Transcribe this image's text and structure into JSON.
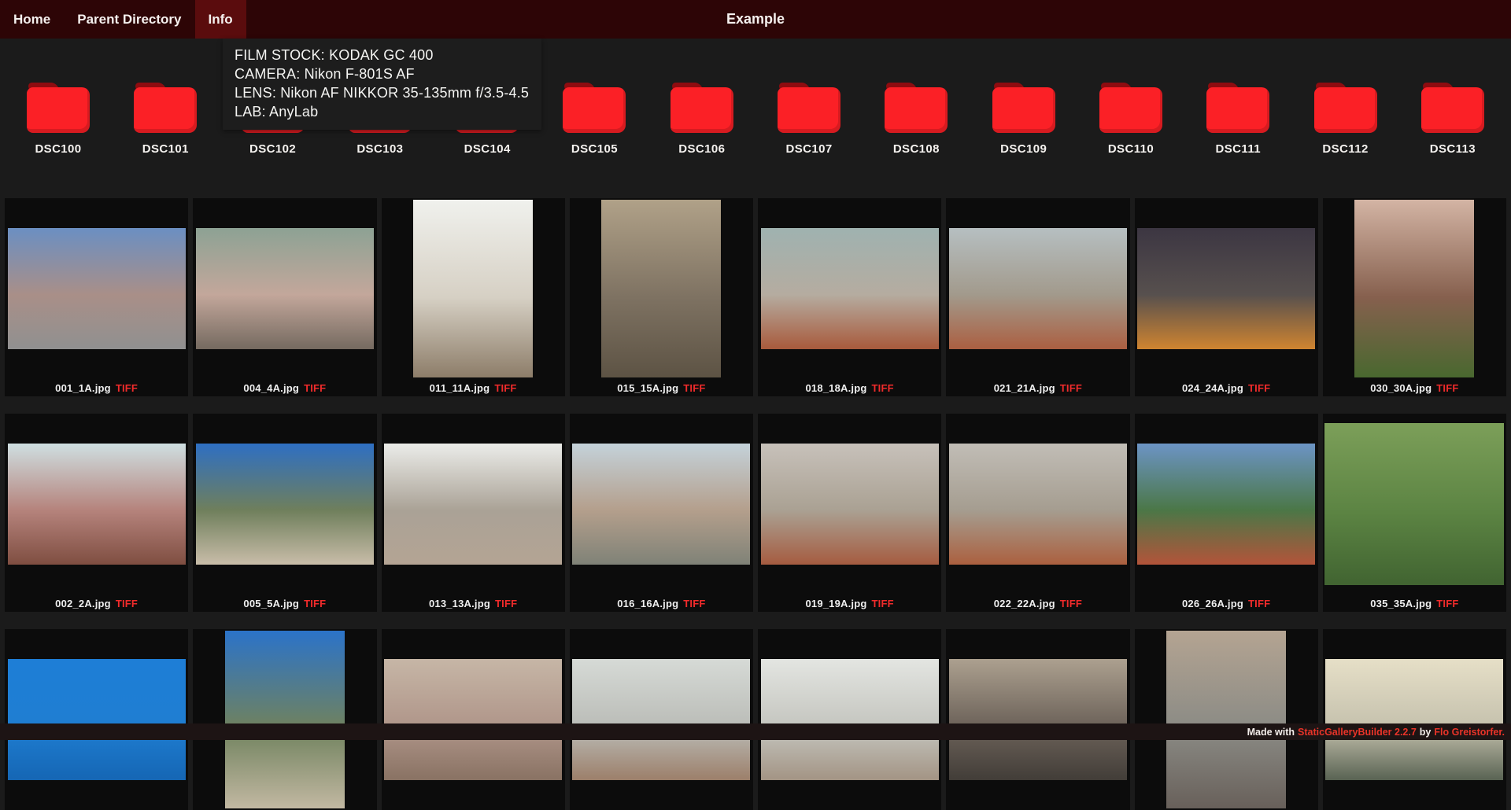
{
  "nav": {
    "items": [
      {
        "label": "Home",
        "active": false
      },
      {
        "label": "Parent Directory",
        "active": false
      },
      {
        "label": "Info",
        "active": true
      }
    ],
    "title": "Example"
  },
  "info_panel": {
    "lines": [
      "FILM STOCK: KODAK GC 400",
      "CAMERA: Nikon F-801S AF",
      "LENS: Nikon AF NIKKOR 35-135mm f/3.5-4.5",
      "LAB: AnyLab"
    ]
  },
  "folders": [
    "DSC100",
    "DSC101",
    "DSC102",
    "DSC103",
    "DSC104",
    "DSC105",
    "DSC106",
    "DSC107",
    "DSC108",
    "DSC109",
    "DSC110",
    "DSC111",
    "DSC112",
    "DSC113"
  ],
  "gallery": {
    "tiff_label": "TIFF",
    "rows": [
      [
        {
          "filename": "001_1A.jpg",
          "orientation": "landscape",
          "gradient": [
            "#6b8fc2",
            "#a98f88",
            "#909090"
          ]
        },
        {
          "filename": "004_4A.jpg",
          "orientation": "landscape",
          "gradient": [
            "#8da294",
            "#c3a79b",
            "#756a60"
          ]
        },
        {
          "filename": "011_11A.jpg",
          "orientation": "portrait",
          "gradient": [
            "#f0f1ed",
            "#d6d0c4",
            "#8d7d69"
          ]
        },
        {
          "filename": "015_15A.jpg",
          "orientation": "portrait",
          "gradient": [
            "#b0a188",
            "#7e7262",
            "#5d5344"
          ]
        },
        {
          "filename": "018_18A.jpg",
          "orientation": "landscape",
          "gradient": [
            "#9fb2b0",
            "#b5aca0",
            "#a85a3c"
          ]
        },
        {
          "filename": "021_21A.jpg",
          "orientation": "landscape",
          "gradient": [
            "#b6bfc1",
            "#a29a8c",
            "#ab5f41"
          ]
        },
        {
          "filename": "024_24A.jpg",
          "orientation": "landscape",
          "gradient": [
            "#3c3642",
            "#57504e",
            "#cf8430"
          ]
        },
        {
          "filename": "030_30A.jpg",
          "orientation": "portrait",
          "gradient": [
            "#d3b4a4",
            "#86604e",
            "#49682f"
          ]
        }
      ],
      [
        {
          "filename": "002_2A.jpg",
          "orientation": "landscape",
          "gradient": [
            "#cfdfe1",
            "#b5837c",
            "#7f4e41"
          ]
        },
        {
          "filename": "005_5A.jpg",
          "orientation": "landscape",
          "gradient": [
            "#2e6fc3",
            "#6f7f5c",
            "#c9bda9"
          ]
        },
        {
          "filename": "013_13A.jpg",
          "orientation": "landscape",
          "gradient": [
            "#ebece9",
            "#aaa296",
            "#b4a494"
          ]
        },
        {
          "filename": "016_16A.jpg",
          "orientation": "landscape",
          "gradient": [
            "#c4d2da",
            "#b49f8c",
            "#7f8277"
          ]
        },
        {
          "filename": "019_19A.jpg",
          "orientation": "landscape",
          "gradient": [
            "#c7c1ba",
            "#aaa193",
            "#a55c40"
          ]
        },
        {
          "filename": "022_22A.jpg",
          "orientation": "landscape",
          "gradient": [
            "#c1bdb6",
            "#a59d90",
            "#ab603f"
          ]
        },
        {
          "filename": "026_26A.jpg",
          "orientation": "landscape",
          "gradient": [
            "#6c94c5",
            "#4b7747",
            "#b3543a"
          ]
        },
        {
          "filename": "035_35A.jpg",
          "orientation": "square",
          "gradient": [
            "#7c9f59",
            "#5c8443",
            "#416431"
          ]
        }
      ],
      [
        {
          "filename": "",
          "orientation": "landscape",
          "gradient": [
            "#1e7ed6",
            "#1f7ed2",
            "#1566b4"
          ]
        },
        {
          "filename": "",
          "orientation": "portrait",
          "gradient": [
            "#2b73c9",
            "#70825e",
            "#c2b8a2"
          ]
        },
        {
          "filename": "",
          "orientation": "landscape",
          "gradient": [
            "#c6b6a6",
            "#b0968a",
            "#897263"
          ]
        },
        {
          "filename": "",
          "orientation": "landscape",
          "gradient": [
            "#d6dad6",
            "#bbbdb8",
            "#9c7f6a"
          ]
        },
        {
          "filename": "",
          "orientation": "landscape",
          "gradient": [
            "#e3e5e1",
            "#c5c6c0",
            "#a39484"
          ]
        },
        {
          "filename": "",
          "orientation": "landscape",
          "gradient": [
            "#aca08f",
            "#6d635a",
            "#423d38"
          ]
        },
        {
          "filename": "",
          "orientation": "portrait",
          "gradient": [
            "#b4a492",
            "#8b8b85",
            "#68605a"
          ]
        },
        {
          "filename": "",
          "orientation": "landscape",
          "gradient": [
            "#e6dfc7",
            "#c6c2ae",
            "#596353"
          ]
        }
      ]
    ]
  },
  "footer": {
    "prefix": "Made with",
    "builder": "StaticGalleryBuilder 2.2.7",
    "by": "by",
    "author": "Flo Greistorfer."
  },
  "colors": {
    "page_bg": "#1b1b1b",
    "cell_bg": "#0c0c0c",
    "nav_bg": "#2d0506",
    "nav_active_bg": "#5a0c0d",
    "panel_bg": "#1d1d1d",
    "folder_body": "#fb2026",
    "folder_tab": "#8e0c10",
    "tiff_red": "#f12b2b",
    "link_red": "#ea3429",
    "footer_bg": "#1d1414"
  }
}
